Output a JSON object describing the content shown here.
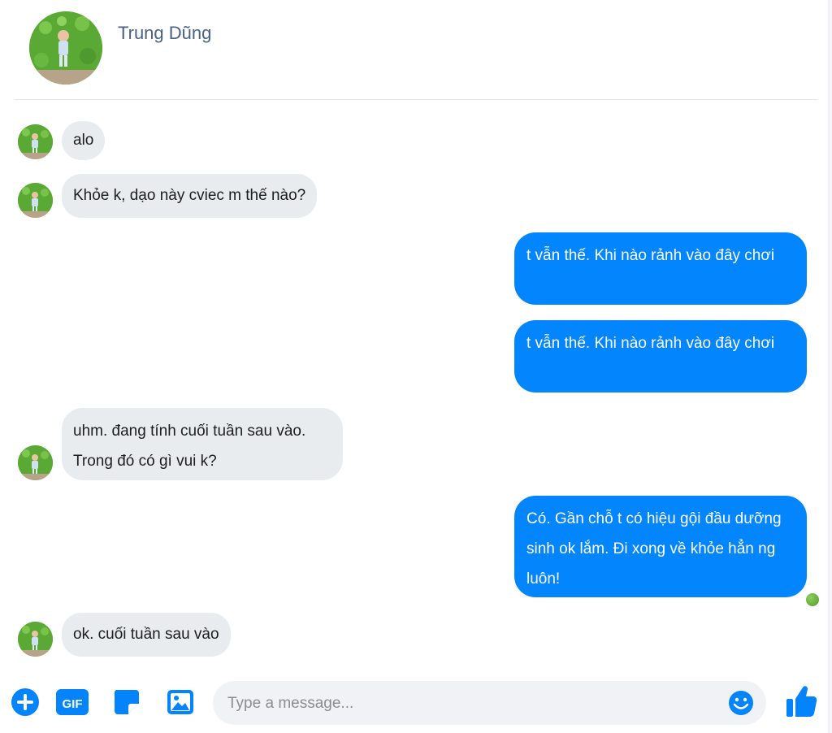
{
  "header": {
    "name": "Trung Dũng",
    "avatar_icon": "child-photo-avatar"
  },
  "messages": [
    {
      "from": "contact",
      "text": "alo"
    },
    {
      "from": "contact",
      "text": "Khỏe k, dạo này cviec m thế nào?"
    },
    {
      "from": "me",
      "text": "t vẫn thế. Khi nào rảnh vào đây chơi"
    },
    {
      "from": "me",
      "text": "t vẫn thế. Khi nào rảnh vào đây chơi"
    },
    {
      "from": "contact",
      "text": "uhm. đang tính cuối tuần sau vào. Trong đó có gì vui k?"
    },
    {
      "from": "me",
      "text": "Có. Gần chỗ t có hiệu gội đầu dưỡng sinh ok lắm. Đi xong về khỏe hẳn ng luôn!"
    },
    {
      "from": "contact",
      "text": "ok. cuối tuần sau vào"
    }
  ],
  "composer": {
    "placeholder": "Type a message...",
    "value": "",
    "icons": [
      "plus-icon",
      "gif-icon",
      "sticker-icon",
      "image-icon",
      "emoji-icon",
      "thumbs-up-icon"
    ],
    "gif_label": "GIF",
    "accent_color": "#0384fc"
  },
  "colors": {
    "outgoing_bubble": "#0385fd",
    "incoming_bubble": "#e9ecef",
    "header_name": "#4a6182"
  }
}
